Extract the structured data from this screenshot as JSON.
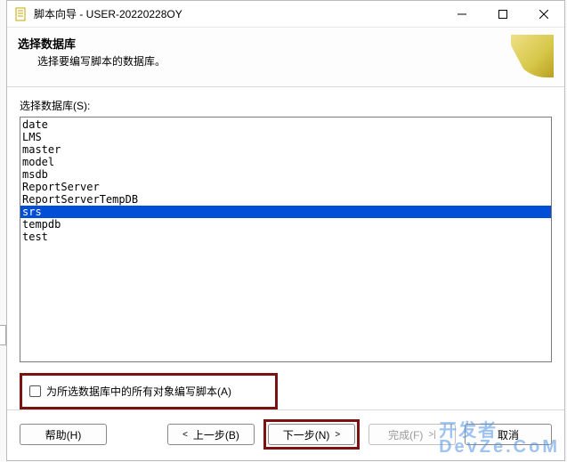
{
  "title": "脚本向导 - USER-20220228OY",
  "header": {
    "title": "选择数据库",
    "subtitle": "选择要编写脚本的数据库。"
  },
  "selectLabel": "选择数据库(S):",
  "databases": {
    "items": [
      "date",
      "LMS",
      "master",
      "model",
      "msdb",
      "ReportServer",
      "ReportServerTempDB",
      "srs",
      "tempdb",
      "test"
    ],
    "selected": "srs"
  },
  "checkbox": {
    "label": "为所选数据库中的所有对象编写脚本(A)"
  },
  "buttons": {
    "help": "帮助(H)",
    "back": "上一步(B)",
    "next": "下一步(N)",
    "finish": "完成(F)",
    "cancel": "取消"
  },
  "watermark": {
    "line1": "开发者",
    "line2": "DevZe.CoM"
  }
}
